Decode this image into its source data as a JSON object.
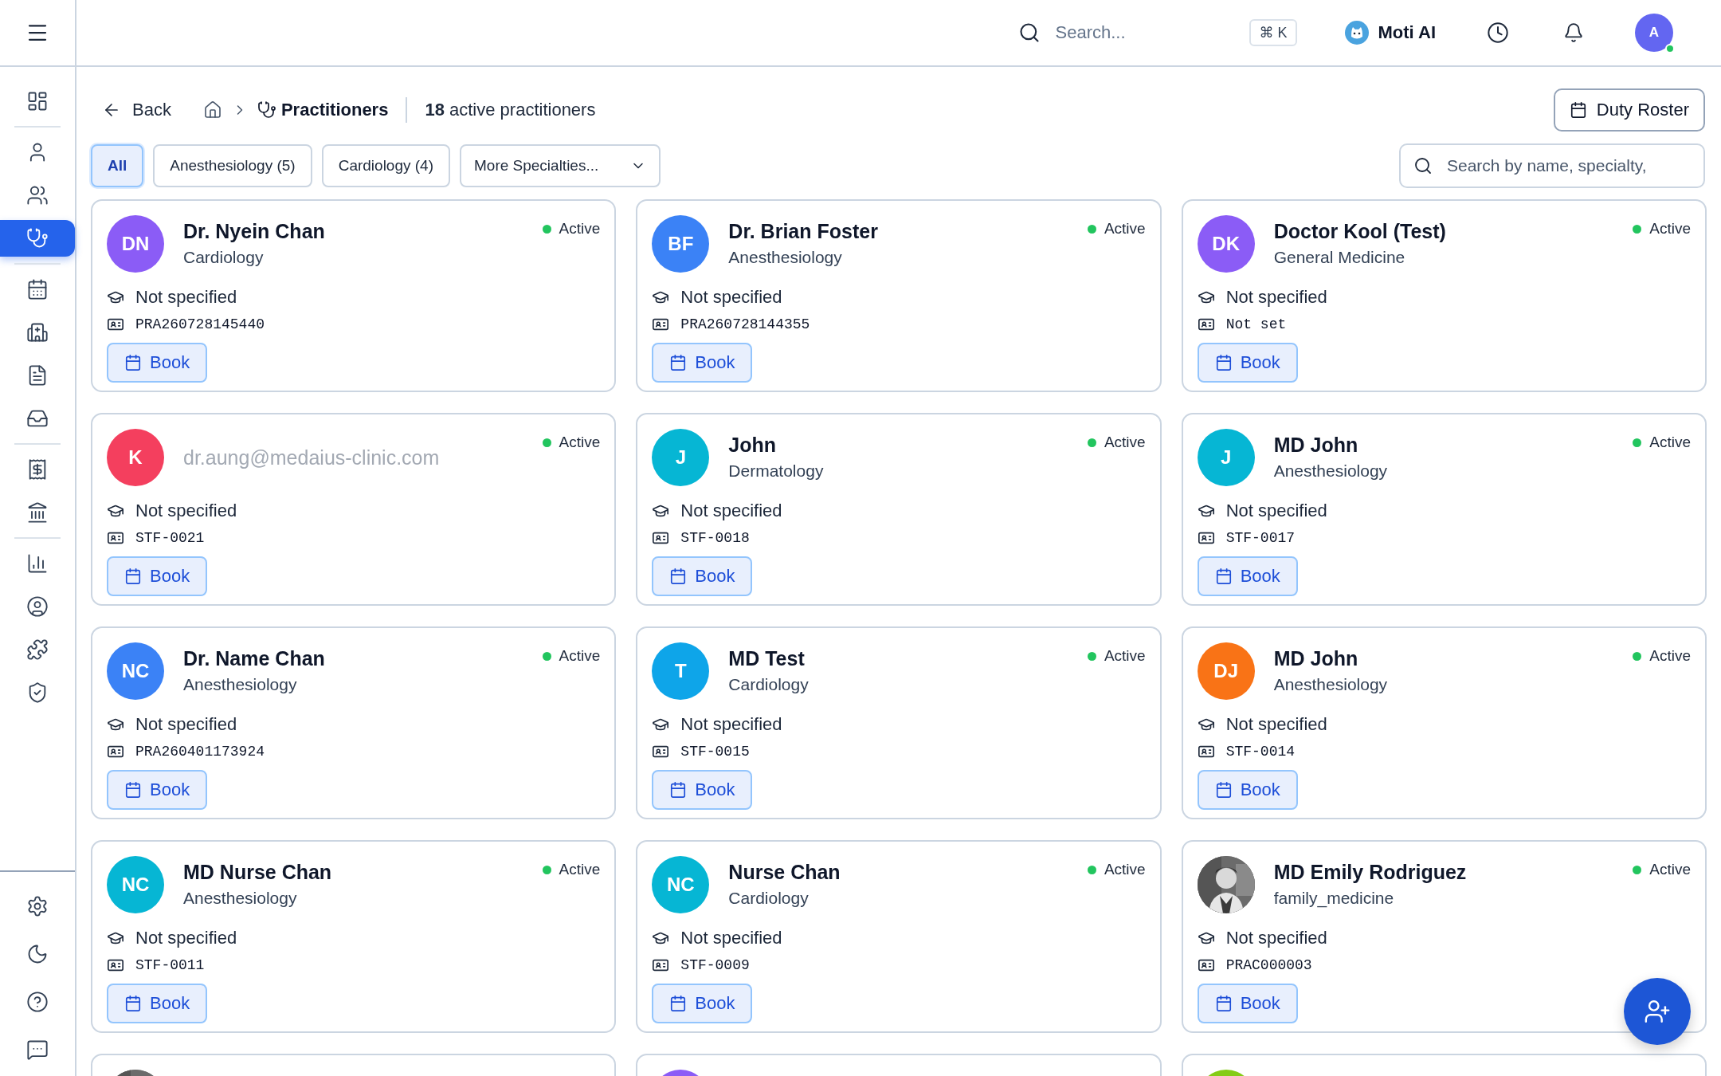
{
  "sidebar": {
    "groups": [
      [
        {
          "selected": false
        }
      ],
      [
        {
          "selected": false
        },
        {
          "selected": false
        },
        {
          "selected": true
        }
      ],
      [
        {
          "selected": false
        },
        {
          "selected": false
        },
        {
          "selected": false
        },
        {
          "selected": false
        }
      ],
      [
        {
          "selected": false
        },
        {
          "selected": false
        }
      ],
      [
        {
          "selected": false
        },
        {
          "selected": false
        },
        {
          "selected": false
        },
        {
          "selected": false
        }
      ]
    ],
    "footer": [
      {
        "selected": false
      },
      {
        "selected": false
      },
      {
        "selected": false
      },
      {
        "selected": false
      }
    ]
  },
  "topbar": {
    "search": {
      "placeholder": "Search..."
    },
    "shortcut": "⌘ K",
    "assistant": "Moti AI",
    "user": {
      "initial": "A",
      "online": true
    }
  },
  "header": {
    "back": "Back",
    "breadcrumb": "Practitioners",
    "summary": "**18** active practitioners",
    "action": "Duty Roster"
  },
  "filters": [
    {
      "label": "All",
      "selected": true,
      "kind": "chip"
    },
    {
      "label": "Anesthesiology (5)",
      "selected": false,
      "kind": "chip"
    },
    {
      "label": "Cardiology (4)",
      "selected": false,
      "kind": "chip"
    },
    {
      "label": "More Specialties...",
      "selected": false,
      "kind": "dropdown"
    }
  ],
  "search": {
    "placeholder": "Search by name, specialty,"
  },
  "cards": [
    {
      "avatar": {
        "kind": "initials",
        "text": "DN",
        "color": "#8b5cf6"
      },
      "kind": "name",
      "name": "Dr. Nyein Chan",
      "specialty": "Cardiology",
      "status": "Active",
      "active": true,
      "qualification": "Not specified",
      "id": "PRA260728145440",
      "book": "Book"
    },
    {
      "avatar": {
        "kind": "initials",
        "text": "BF",
        "color": "#3b82f6"
      },
      "kind": "name",
      "name": "Dr. Brian Foster",
      "specialty": "Anesthesiology",
      "status": "Active",
      "active": true,
      "qualification": "Not specified",
      "id": "PRA260728144355",
      "book": "Book"
    },
    {
      "avatar": {
        "kind": "initials",
        "text": "DK",
        "color": "#8b5cf6"
      },
      "kind": "name",
      "name": "Doctor Kool (Test)",
      "specialty": "General Medicine",
      "status": "Active",
      "active": true,
      "qualification": "Not specified",
      "id": "Not set",
      "book": "Book"
    },
    {
      "avatar": {
        "kind": "initials",
        "text": "K",
        "color": "#f43f5e"
      },
      "kind": "email",
      "name": "dr.aung@medaius-clinic.com",
      "status": "Active",
      "active": true,
      "qualification": "Not specified",
      "id": "STF-0021",
      "book": "Book"
    },
    {
      "avatar": {
        "kind": "initials",
        "text": "J",
        "color": "#06b6d4"
      },
      "kind": "name",
      "name": "John",
      "specialty": "Dermatology",
      "status": "Active",
      "active": true,
      "qualification": "Not specified",
      "id": "STF-0018",
      "book": "Book"
    },
    {
      "avatar": {
        "kind": "initials",
        "text": "J",
        "color": "#06b6d4"
      },
      "kind": "name",
      "name": "MD John",
      "specialty": "Anesthesiology",
      "status": "Active",
      "active": true,
      "qualification": "Not specified",
      "id": "STF-0017",
      "book": "Book"
    },
    {
      "avatar": {
        "kind": "initials",
        "text": "NC",
        "color": "#3b82f6"
      },
      "kind": "name",
      "name": "Dr. Name Chan",
      "specialty": "Anesthesiology",
      "status": "Active",
      "active": true,
      "qualification": "Not specified",
      "id": "PRA260401173924",
      "book": "Book"
    },
    {
      "avatar": {
        "kind": "initials",
        "text": "T",
        "color": "#0ea5e9"
      },
      "kind": "name",
      "name": "MD Test",
      "specialty": "Cardiology",
      "status": "Active",
      "active": true,
      "qualification": "Not specified",
      "id": "STF-0015",
      "book": "Book"
    },
    {
      "avatar": {
        "kind": "initials",
        "text": "DJ",
        "color": "#f97316"
      },
      "kind": "name",
      "name": "MD John",
      "specialty": "Anesthesiology",
      "status": "Active",
      "active": true,
      "qualification": "Not specified",
      "id": "STF-0014",
      "book": "Book"
    },
    {
      "avatar": {
        "kind": "initials",
        "text": "NC",
        "color": "#06b6d4"
      },
      "kind": "name",
      "name": "MD Nurse Chan",
      "specialty": "Anesthesiology",
      "status": "Active",
      "active": true,
      "qualification": "Not specified",
      "id": "STF-0011",
      "book": "Book"
    },
    {
      "avatar": {
        "kind": "initials",
        "text": "NC",
        "color": "#06b6d4"
      },
      "kind": "name",
      "name": "Nurse Chan",
      "specialty": "Cardiology",
      "status": "Active",
      "active": true,
      "qualification": "Not specified",
      "id": "STF-0009",
      "book": "Book"
    },
    {
      "avatar": {
        "kind": "picture"
      },
      "kind": "name",
      "name": "MD Emily Rodriguez",
      "specialty": "family_medicine",
      "status": "Active",
      "active": true,
      "qualification": "Not specified",
      "id": "PRAC000003",
      "book": "Book"
    }
  ],
  "partial_cards": [
    {
      "avatar": {
        "kind": "picture"
      }
    },
    {
      "avatar": {
        "kind": "initials",
        "color": "#8b5cf6"
      }
    },
    {
      "avatar": {
        "kind": "initials",
        "color": "#84cc16"
      }
    }
  ]
}
